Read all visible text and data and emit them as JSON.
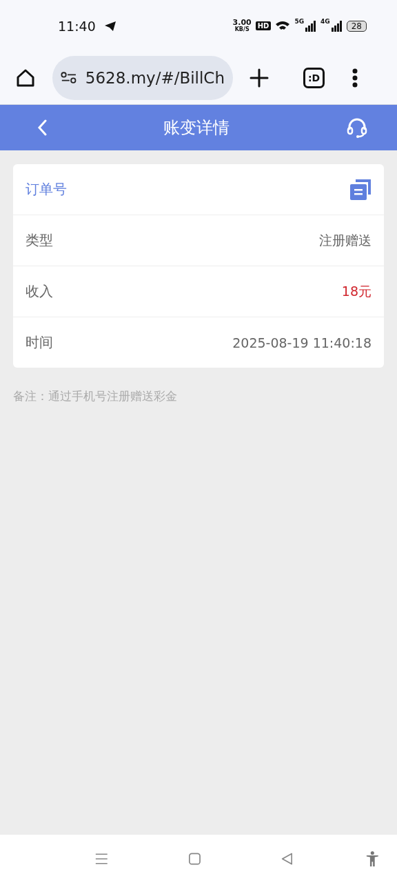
{
  "status_bar": {
    "time": "11:40",
    "speed_value": "3.00",
    "speed_unit": "KB/S",
    "hd_badge": "HD",
    "network_1": "5G",
    "network_2": "4G",
    "battery": "28"
  },
  "browser": {
    "url": "5628.my/#/BillCh",
    "tab_label": ":D"
  },
  "header": {
    "title": "账变详情"
  },
  "rows": [
    {
      "kind": "header",
      "label": "订单号"
    },
    {
      "kind": "text",
      "label": "类型",
      "value": "注册赠送"
    },
    {
      "kind": "amount",
      "label": "收入",
      "value": "18元"
    },
    {
      "kind": "text",
      "label": "时间",
      "value": "2025-08-19 11:40:18"
    }
  ],
  "note": "备注：通过手机号注册赠送彩金"
}
